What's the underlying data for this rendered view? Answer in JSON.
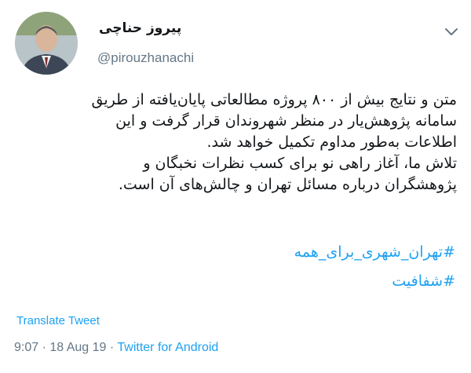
{
  "tweet": {
    "author": {
      "display_name": "پیروز حناچی",
      "handle": "@pirouzhanachi"
    },
    "body_lines": [
      "متن و نتایج بیش از ۸۰۰ پروژه مطالعاتی پایان‌یافته از طریق",
      "سامانه پژوهش‌یار در منظر شهروندان قرار گرفت و این",
      "اطلاعات به‌طور مداوم تکمیل خواهد شد.",
      "تلاش ما، آغاز راهی نو برای کسب نظرات نخبگان و",
      "پژوهشگران درباره مسائل تهران و چالش‌های آن است."
    ],
    "hashtags": [
      "#تهران_شهری_برای_همه",
      "#شفافیت"
    ],
    "translate_label": "Translate Tweet",
    "time": "9:07",
    "date": "18 Aug 19",
    "source": "Twitter for Android",
    "separator": " · "
  },
  "colors": {
    "link": "#1da1f2",
    "muted": "#657786",
    "text": "#14171a"
  },
  "icons": {
    "menu": "chevron-down-icon",
    "avatar": "avatar"
  }
}
